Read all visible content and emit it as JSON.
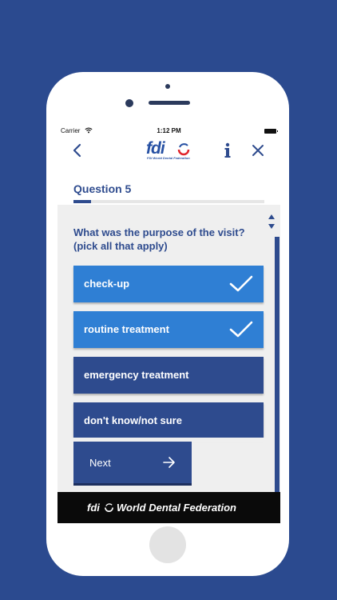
{
  "status_bar": {
    "carrier": "Carrier",
    "time": "1:12 PM"
  },
  "nav": {
    "back_icon": "chevron-left-icon",
    "logo_text": "fdi",
    "logo_subtitle": "FDI World Dental Federation",
    "info_icon": "info-icon",
    "close_icon": "close-icon"
  },
  "quiz": {
    "question_title": "Question 5",
    "progress": 0.09,
    "question_text": "What was the purpose of the visit? (pick all that apply)",
    "options": [
      {
        "label": "check-up",
        "selected": true
      },
      {
        "label": "routine treatment",
        "selected": true
      },
      {
        "label": "emergency treatment",
        "selected": false
      },
      {
        "label": "don't know/not sure",
        "selected": false
      }
    ],
    "next_label": "Next"
  },
  "footer": {
    "logo_text": "fdi",
    "org_name": "World Dental Federation"
  },
  "colors": {
    "background": "#2b4a8f",
    "primary": "#2e4b8e",
    "selected": "#2f7fd4",
    "logo_red": "#e0242b",
    "footer": "#0a0a0a"
  }
}
